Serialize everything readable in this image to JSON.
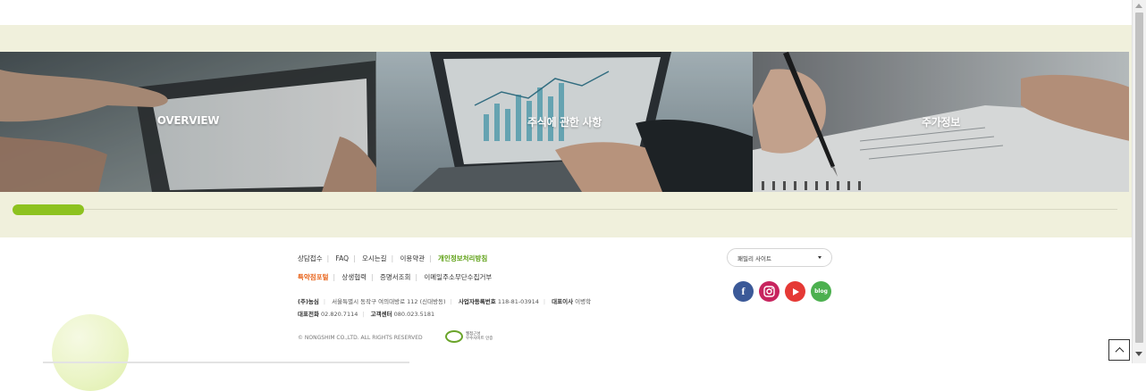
{
  "cards": [
    {
      "label": "OVERVIEW"
    },
    {
      "label": "주식에 관한 사항"
    },
    {
      "label": "주가정보"
    }
  ],
  "slider": {
    "progress": 0.065,
    "accent_color": "#8dc21f"
  },
  "footer": {
    "links_row1": [
      "상담접수",
      "FAQ",
      "오시는길",
      "이용약관",
      "개인정보처리방침"
    ],
    "links_row2": [
      "특약점포털",
      "상생협력",
      "증명서조회",
      "이메일주소무단수집거부"
    ],
    "info_line1": {
      "company": "(주)농심",
      "address": "서울특별시 동작구 여의대방로 112 (신대방동)",
      "bizno_label": "사업자등록번호",
      "bizno": "118-81-03914",
      "ceo_label": "대표이사",
      "ceo": "이병학"
    },
    "info_line2": {
      "phone_label": "대표전화",
      "phone": "02.820.7114",
      "cs_label": "고객센터",
      "cs": "080.023.5181"
    },
    "copyright": "© NONGSHIM CO.,LTD. ALL RIGHTS RESERVED",
    "cert_text": [
      "웹접근성",
      "우수사이트 인증"
    ],
    "family_site": "패밀리 사이트",
    "sns": {
      "facebook": "f",
      "blog": "blog"
    }
  },
  "icons": [
    "facebook-icon",
    "instagram-icon",
    "youtube-icon",
    "blog-icon",
    "chevron-up-icon",
    "caret-down-icon"
  ],
  "colors": {
    "band_bg": "#f0f0dc",
    "green": "#5a9e0f",
    "orange": "#e8641b"
  }
}
